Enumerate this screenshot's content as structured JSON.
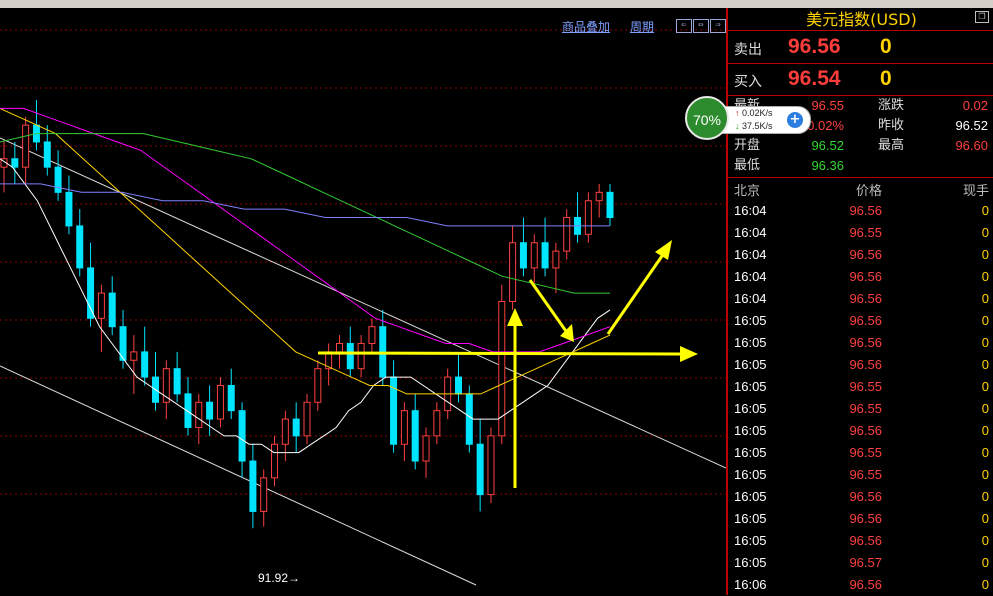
{
  "chart_toolbar": {
    "overlay_link": "商品叠加",
    "period_link": "周期",
    "nav_buttons": [
      "⇐",
      "⇔",
      "⇒"
    ]
  },
  "chart_data": {
    "type": "candlestick",
    "low_marker": "91.92",
    "candles": [
      [
        96.2,
        96.5,
        95.9,
        96.3
      ],
      [
        96.3,
        96.5,
        96.0,
        96.2
      ],
      [
        96.2,
        96.8,
        96.0,
        96.7
      ],
      [
        96.7,
        97.0,
        96.4,
        96.5
      ],
      [
        96.5,
        96.7,
        96.1,
        96.2
      ],
      [
        96.2,
        96.4,
        95.8,
        95.9
      ],
      [
        95.9,
        96.1,
        95.4,
        95.5
      ],
      [
        95.5,
        95.7,
        94.9,
        95.0
      ],
      [
        95.0,
        95.3,
        94.3,
        94.4
      ],
      [
        94.4,
        94.8,
        94.0,
        94.7
      ],
      [
        94.7,
        94.9,
        94.2,
        94.3
      ],
      [
        94.3,
        94.5,
        93.8,
        93.9
      ],
      [
        93.9,
        94.2,
        93.5,
        94.0
      ],
      [
        94.0,
        94.3,
        93.6,
        93.7
      ],
      [
        93.7,
        94.0,
        93.3,
        93.4
      ],
      [
        93.4,
        93.9,
        93.2,
        93.8
      ],
      [
        93.8,
        94.0,
        93.4,
        93.5
      ],
      [
        93.5,
        93.7,
        93.0,
        93.1
      ],
      [
        93.1,
        93.5,
        92.9,
        93.4
      ],
      [
        93.4,
        93.6,
        93.0,
        93.2
      ],
      [
        93.2,
        93.7,
        93.1,
        93.6
      ],
      [
        93.6,
        93.8,
        93.2,
        93.3
      ],
      [
        93.3,
        93.4,
        92.5,
        92.7
      ],
      [
        92.7,
        92.9,
        91.9,
        92.1
      ],
      [
        92.1,
        92.6,
        91.92,
        92.5
      ],
      [
        92.5,
        93.0,
        92.4,
        92.9
      ],
      [
        92.9,
        93.3,
        92.7,
        93.2
      ],
      [
        93.2,
        93.4,
        92.8,
        93.0
      ],
      [
        93.0,
        93.5,
        92.9,
        93.4
      ],
      [
        93.4,
        93.9,
        93.3,
        93.8
      ],
      [
        93.8,
        94.1,
        93.6,
        94.0
      ],
      [
        94.0,
        94.2,
        93.8,
        94.1
      ],
      [
        94.1,
        94.3,
        93.7,
        93.8
      ],
      [
        93.8,
        94.2,
        93.7,
        94.1
      ],
      [
        94.1,
        94.4,
        94.0,
        94.3
      ],
      [
        94.3,
        94.5,
        93.6,
        93.7
      ],
      [
        93.7,
        93.9,
        92.8,
        92.9
      ],
      [
        92.9,
        93.4,
        92.7,
        93.3
      ],
      [
        93.3,
        93.5,
        92.6,
        92.7
      ],
      [
        92.7,
        93.1,
        92.5,
        93.0
      ],
      [
        93.0,
        93.4,
        92.9,
        93.3
      ],
      [
        93.3,
        93.8,
        93.2,
        93.7
      ],
      [
        93.7,
        94.0,
        93.4,
        93.5
      ],
      [
        93.5,
        93.6,
        92.8,
        92.9
      ],
      [
        92.9,
        93.2,
        92.1,
        92.3
      ],
      [
        92.3,
        93.1,
        92.2,
        93.0
      ],
      [
        93.0,
        94.8,
        92.9,
        94.6
      ],
      [
        94.6,
        95.5,
        94.5,
        95.3
      ],
      [
        95.3,
        95.6,
        94.9,
        95.0
      ],
      [
        95.0,
        95.4,
        94.8,
        95.3
      ],
      [
        95.3,
        95.6,
        94.9,
        95.0
      ],
      [
        95.0,
        95.3,
        94.7,
        95.2
      ],
      [
        95.2,
        95.7,
        95.1,
        95.6
      ],
      [
        95.6,
        95.9,
        95.3,
        95.4
      ],
      [
        95.4,
        95.9,
        95.3,
        95.8
      ],
      [
        95.8,
        96.0,
        95.6,
        95.9
      ],
      [
        95.9,
        96.0,
        95.5,
        95.6
      ]
    ],
    "moving_averages": [
      {
        "color": "#ffffff",
        "values": [
          96.3,
          96.2,
          96.0,
          95.8,
          95.5,
          95.2,
          94.9,
          94.6,
          94.3,
          94.1,
          93.9,
          93.7,
          93.6,
          93.5,
          93.4,
          93.3,
          93.2,
          93.1,
          93.0,
          93.0,
          92.9,
          92.9,
          92.8,
          92.8,
          92.8,
          92.9,
          93.0,
          93.1,
          93.3,
          93.4,
          93.6,
          93.7,
          93.7,
          93.7,
          93.6,
          93.5,
          93.4,
          93.3,
          93.2,
          93.2,
          93.2,
          93.3,
          93.4,
          93.5,
          93.6,
          93.8,
          94.0,
          94.2,
          94.4,
          94.5
        ]
      },
      {
        "color": "#ffd200",
        "values": [
          96.9,
          96.8,
          96.7,
          96.6,
          96.4,
          96.2,
          96.0,
          95.8,
          95.6,
          95.4,
          95.2,
          95.0,
          94.8,
          94.6,
          94.4,
          94.2,
          94.0,
          93.9,
          93.8,
          93.7,
          93.6,
          93.6,
          93.5,
          93.5,
          93.5,
          93.5,
          93.5,
          93.6,
          93.7,
          93.8,
          93.9,
          94.0,
          94.1,
          94.2
        ]
      },
      {
        "color": "#ff00ff",
        "values": [
          96.9,
          96.9,
          96.8,
          96.7,
          96.6,
          96.5,
          96.4,
          96.2,
          96.0,
          95.8,
          95.6,
          95.4,
          95.2,
          95.0,
          94.8,
          94.6,
          94.4,
          94.3,
          94.2,
          94.1,
          94.1,
          94.0,
          94.0,
          94.0,
          94.1,
          94.2,
          94.3
        ]
      },
      {
        "color": "#33cc33",
        "values": [
          96.5,
          96.6,
          96.6,
          96.6,
          96.6,
          96.5,
          96.4,
          96.3,
          96.1,
          95.9,
          95.7,
          95.5,
          95.3,
          95.1,
          94.9,
          94.8,
          94.7,
          94.7
        ]
      },
      {
        "color": "#8080ff",
        "values": [
          96.0,
          96.0,
          95.9,
          95.9,
          95.8,
          95.8,
          95.7,
          95.7,
          95.6,
          95.6,
          95.6,
          95.5,
          95.5,
          95.5,
          95.5,
          95.5
        ]
      }
    ]
  },
  "panel": {
    "title": "美元指数(USD)",
    "sell": {
      "label": "卖出",
      "price": "96.56",
      "volume": "0"
    },
    "buy": {
      "label": "买入",
      "price": "96.54",
      "volume": "0"
    },
    "stats": {
      "latest_label": "最新",
      "latest_value": "96.55",
      "change_label": "涨跌",
      "change_value": "0.02",
      "pct_label": "幅度",
      "pct_value": "0.02%",
      "prev_label": "昨收",
      "prev_value": "96.52",
      "open_label": "开盘",
      "open_value": "96.52",
      "high_label": "最高",
      "high_value": "96.60",
      "low_label": "最低",
      "low_value": "96.36"
    },
    "ticks_header": {
      "time": "北京",
      "price": "价格",
      "volume": "现手"
    },
    "ticks": [
      {
        "time": "16:04",
        "price": "96.56",
        "volume": "0"
      },
      {
        "time": "16:04",
        "price": "96.55",
        "volume": "0"
      },
      {
        "time": "16:04",
        "price": "96.56",
        "volume": "0"
      },
      {
        "time": "16:04",
        "price": "96.56",
        "volume": "0"
      },
      {
        "time": "16:04",
        "price": "96.56",
        "volume": "0"
      },
      {
        "time": "16:05",
        "price": "96.56",
        "volume": "0"
      },
      {
        "time": "16:05",
        "price": "96.56",
        "volume": "0"
      },
      {
        "time": "16:05",
        "price": "96.56",
        "volume": "0"
      },
      {
        "time": "16:05",
        "price": "96.55",
        "volume": "0"
      },
      {
        "time": "16:05",
        "price": "96.55",
        "volume": "0"
      },
      {
        "time": "16:05",
        "price": "96.56",
        "volume": "0"
      },
      {
        "time": "16:05",
        "price": "96.55",
        "volume": "0"
      },
      {
        "time": "16:05",
        "price": "96.55",
        "volume": "0"
      },
      {
        "time": "16:05",
        "price": "96.56",
        "volume": "0"
      },
      {
        "time": "16:05",
        "price": "96.56",
        "volume": "0"
      },
      {
        "time": "16:05",
        "price": "96.56",
        "volume": "0"
      },
      {
        "time": "16:05",
        "price": "96.57",
        "volume": "0"
      },
      {
        "time": "16:06",
        "price": "96.56",
        "volume": "0"
      }
    ]
  },
  "speed_widget": {
    "percent": "70%",
    "up": "0.02K/s",
    "down": "37.5K/s",
    "plus": "+"
  },
  "colors": {
    "up": "#ff4040",
    "down": "#00e5ff",
    "grid": "#8b0000",
    "panel_border": "#b00000",
    "accent": "#ffd200"
  }
}
